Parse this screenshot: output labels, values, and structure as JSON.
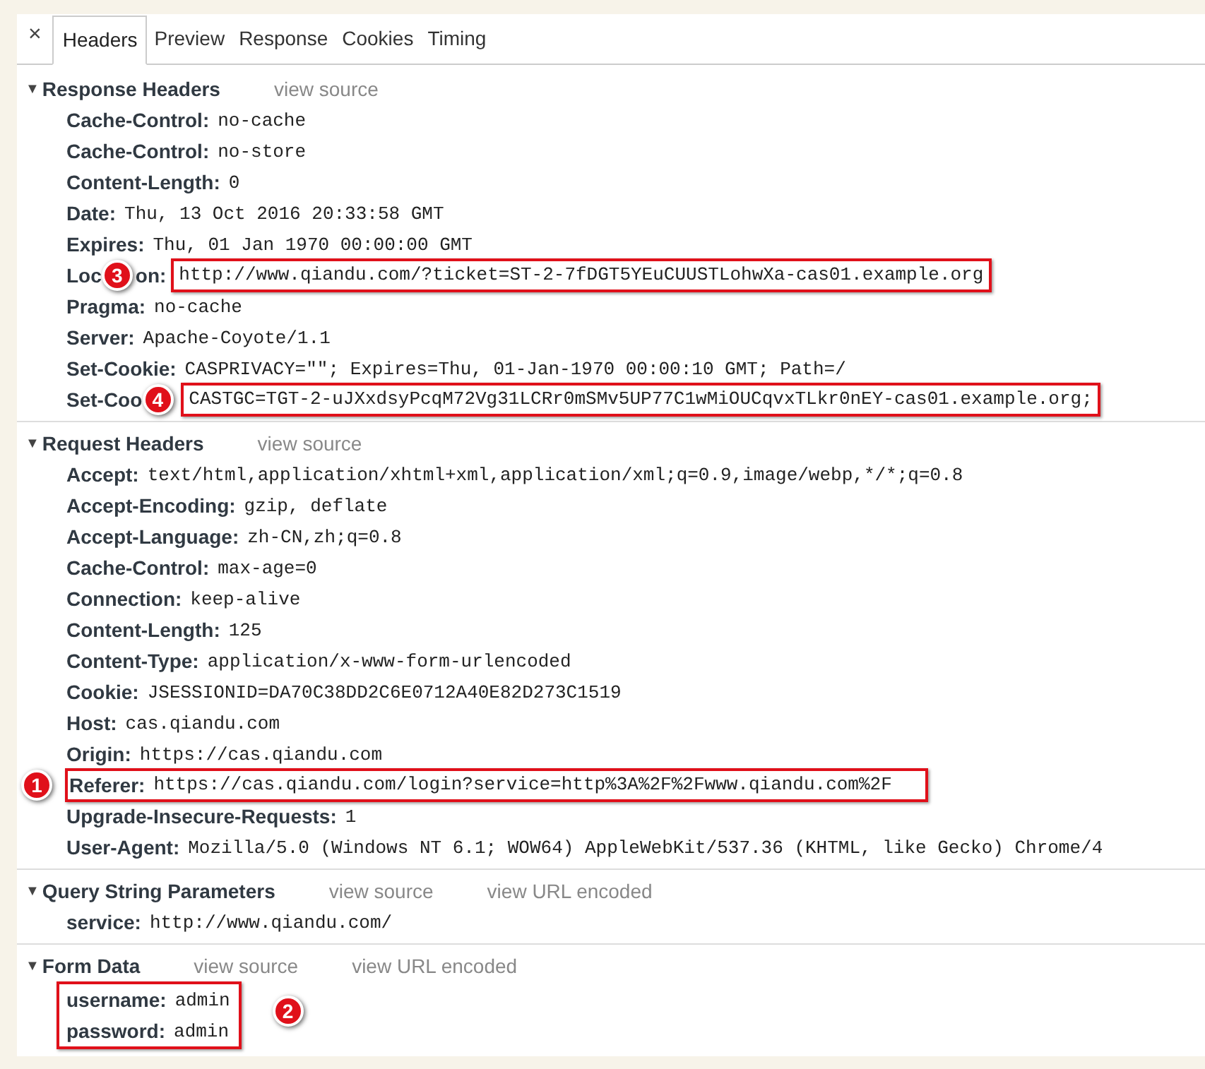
{
  "close_label": "×",
  "tabs": [
    {
      "label": "Headers",
      "selected": true
    },
    {
      "label": "Preview",
      "selected": false
    },
    {
      "label": "Response",
      "selected": false
    },
    {
      "label": "Cookies",
      "selected": false
    },
    {
      "label": "Timing",
      "selected": false
    }
  ],
  "sections": [
    {
      "title": "Response Headers",
      "arrow": "▼",
      "expanded": true,
      "links": [
        "view source"
      ],
      "rows": [
        {
          "name": "Cache-Control:",
          "value": "no-cache"
        },
        {
          "name": "Cache-Control:",
          "value": "no-store"
        },
        {
          "name": "Content-Length:",
          "value": "0"
        },
        {
          "name": "Date:",
          "value": "Thu, 13 Oct 2016 20:33:58 GMT"
        },
        {
          "name": "Expires:",
          "value": "Thu, 01 Jan 1970 00:00:00 GMT"
        },
        {
          "name": "Loc",
          "name_rest": "on:",
          "badge": "3",
          "kind": "boxvalue",
          "value": "http://www.qiandu.com/?ticket=ST-2-7fDGT5YEuCUUSTLohwXa-cas01.example.org"
        },
        {
          "name": "Pragma:",
          "value": "no-cache"
        },
        {
          "name": "Server:",
          "value": "Apache-Coyote/1.1"
        },
        {
          "name": "Set-Cookie:",
          "value": "CASPRIVACY=\"\"; Expires=Thu, 01-Jan-1970 00:00:10 GMT; Path=/"
        },
        {
          "name": "Set-Coo",
          "badge": "4",
          "kind": "boxvalue",
          "value": "CASTGC=TGT-2-uJXxdsyPcqM72Vg31LCRr0mSMv5UP77C1wMiOUCqvxTLkr0nEY-cas01.example.org;"
        }
      ]
    },
    {
      "title": "Request Headers",
      "arrow": "▼",
      "expanded": true,
      "links": [
        "view source"
      ],
      "rows": [
        {
          "name": "Accept:",
          "value": "text/html,application/xhtml+xml,application/xml;q=0.9,image/webp,*/*;q=0.8"
        },
        {
          "name": "Accept-Encoding:",
          "value": "gzip, deflate"
        },
        {
          "name": "Accept-Language:",
          "value": "zh-CN,zh;q=0.8"
        },
        {
          "name": "Cache-Control:",
          "value": "max-age=0"
        },
        {
          "name": "Connection:",
          "value": "keep-alive"
        },
        {
          "name": "Content-Length:",
          "value": "125"
        },
        {
          "name": "Content-Type:",
          "value": "application/x-www-form-urlencoded"
        },
        {
          "name": "Cookie:",
          "value": "JSESSIONID=DA70C38DD2C6E0712A40E82D273C1519"
        },
        {
          "name": "Host:",
          "value": "cas.qiandu.com"
        },
        {
          "name": "Origin:",
          "value": "https://cas.qiandu.com"
        },
        {
          "name": "Referer:",
          "badge": "1",
          "kind": "boxrow",
          "value": "https://cas.qiandu.com/login?service=http%3A%2F%2Fwww.qiandu.com%2F"
        },
        {
          "name": "Upgrade-Insecure-Requests:",
          "value": "1"
        },
        {
          "name": "User-Agent:",
          "value": "Mozilla/5.0 (Windows NT 6.1; WOW64) AppleWebKit/537.36 (KHTML, like Gecko) Chrome/4"
        }
      ]
    },
    {
      "title": "Query String Parameters",
      "arrow": "▼",
      "expanded": true,
      "links": [
        "view source",
        "view URL encoded"
      ],
      "rows": [
        {
          "name": "service:",
          "value": "http://www.qiandu.com/"
        }
      ]
    },
    {
      "title": "Form Data",
      "arrow": "▼",
      "expanded": true,
      "links": [
        "view source",
        "view URL encoded"
      ],
      "boxed": true,
      "badge": "2",
      "rows": [
        {
          "name": "username:",
          "value": "admin"
        },
        {
          "name": "password:",
          "value": "admin"
        }
      ]
    }
  ]
}
